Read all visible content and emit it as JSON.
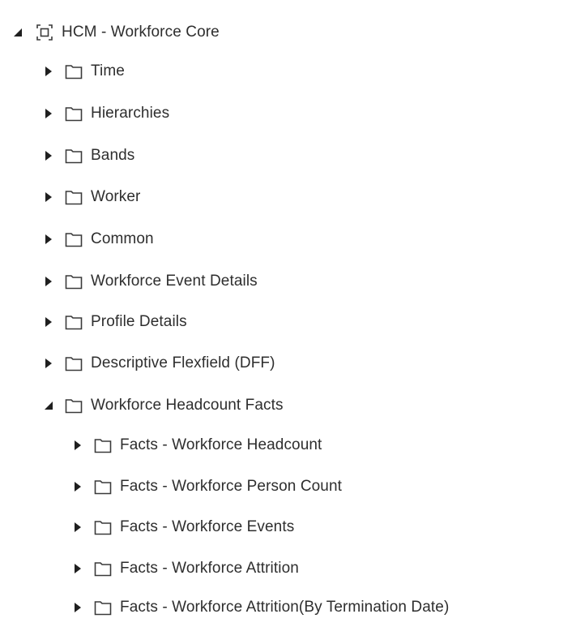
{
  "tree": {
    "root": {
      "label": "HCM - Workforce Core",
      "expanded": true,
      "icon": "subject-area-icon",
      "children": [
        {
          "label": "Time",
          "expanded": false,
          "icon": "folder-icon"
        },
        {
          "label": "Hierarchies",
          "expanded": false,
          "icon": "folder-icon"
        },
        {
          "label": "Bands",
          "expanded": false,
          "icon": "folder-icon"
        },
        {
          "label": "Worker",
          "expanded": false,
          "icon": "folder-icon"
        },
        {
          "label": "Common",
          "expanded": false,
          "icon": "folder-icon"
        },
        {
          "label": "Workforce Event Details",
          "expanded": false,
          "icon": "folder-icon"
        },
        {
          "label": "Profile Details",
          "expanded": false,
          "icon": "folder-icon"
        },
        {
          "label": "Descriptive Flexfield (DFF)",
          "expanded": false,
          "icon": "folder-icon"
        },
        {
          "label": "Workforce Headcount Facts",
          "expanded": true,
          "icon": "folder-icon",
          "children": [
            {
              "label": "Facts - Workforce Headcount",
              "expanded": false,
              "icon": "folder-icon"
            },
            {
              "label": "Facts - Workforce Person Count",
              "expanded": false,
              "icon": "folder-icon"
            },
            {
              "label": "Facts - Workforce Events",
              "expanded": false,
              "icon": "folder-icon"
            },
            {
              "label": "Facts - Workforce Attrition",
              "expanded": false,
              "icon": "folder-icon"
            },
            {
              "label": "Facts - Workforce Attrition(By Termination Date)",
              "expanded": false,
              "icon": "folder-icon"
            }
          ]
        }
      ]
    }
  },
  "colors": {
    "text": "#2e2e2e",
    "toggle": "#1f1f1f",
    "icon_stroke": "#3a3a3a",
    "background": "#ffffff"
  }
}
